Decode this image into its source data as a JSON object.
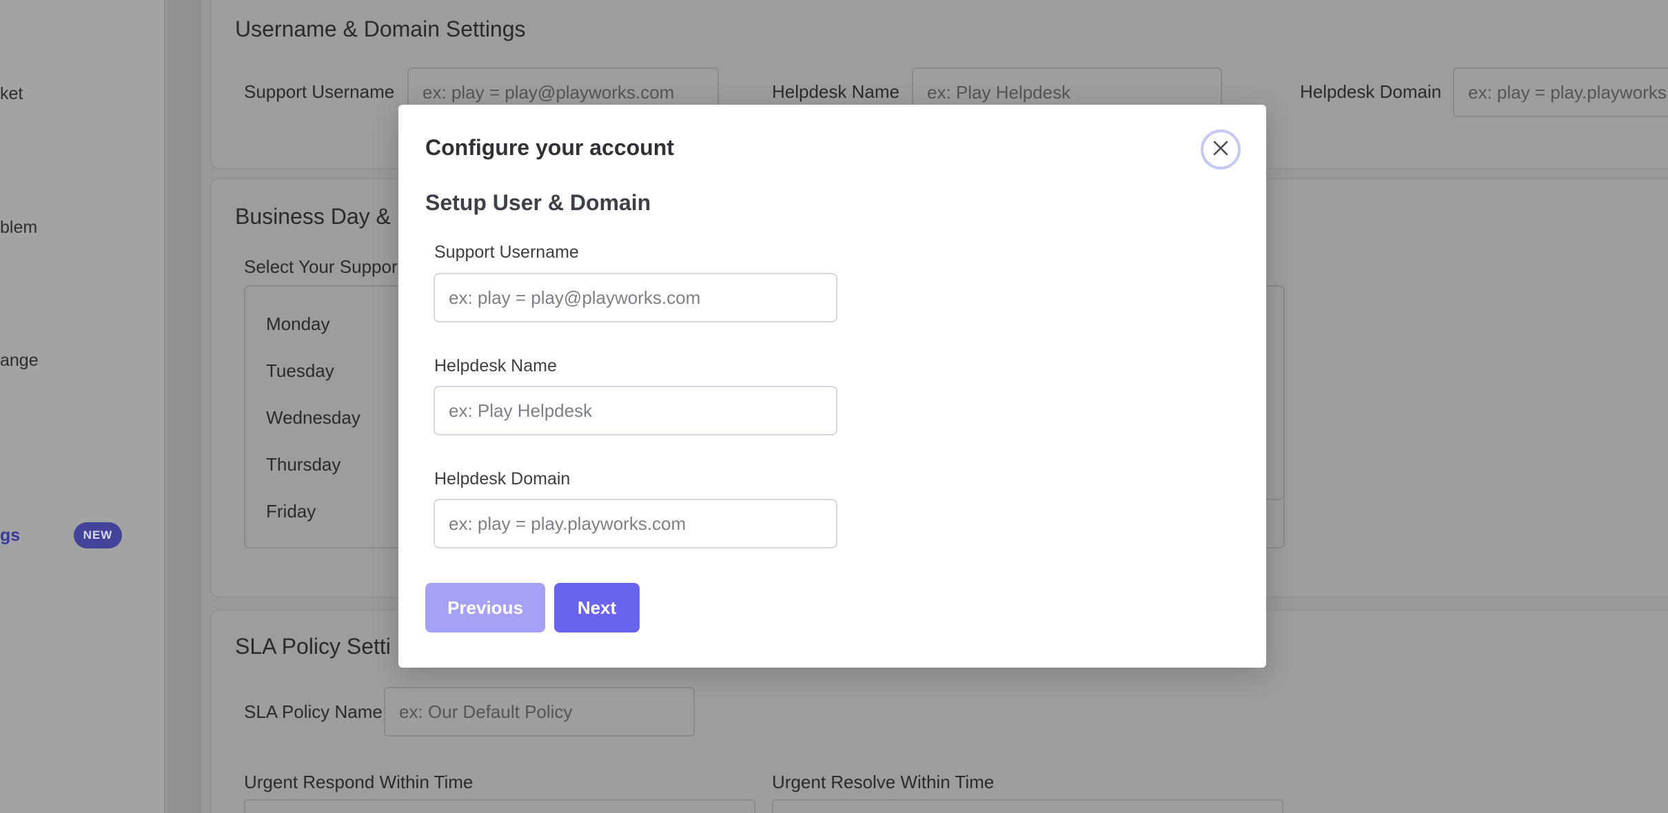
{
  "sidebar": {
    "items": [
      {
        "label": "ket"
      },
      {
        "label": "blem"
      },
      {
        "label": "ange"
      },
      {
        "label": "gs"
      }
    ],
    "badge": "NEW"
  },
  "background": {
    "username_section": {
      "title": "Username & Domain Settings",
      "support_username_label": "Support Username",
      "support_username_placeholder": "ex: play = play@playworks.com",
      "helpdesk_name_label": "Helpdesk Name",
      "helpdesk_name_placeholder": "ex: Play Helpdesk",
      "helpdesk_domain_label": "Helpdesk Domain",
      "helpdesk_domain_placeholder": "ex: play = play.playworks.com"
    },
    "business_section": {
      "title": "Business Day &",
      "select_label": "Select Your Suppor",
      "days": [
        "Monday",
        "Tuesday",
        "Wednesday",
        "Thursday",
        "Friday"
      ]
    },
    "sla_section": {
      "title": "SLA Policy Setti",
      "policy_name_label": "SLA Policy Name",
      "policy_name_placeholder": "ex: Our Default Policy",
      "urgent_respond_label": "Urgent Respond Within Time",
      "urgent_resolve_label": "Urgent Resolve Within Time"
    }
  },
  "modal": {
    "title": "Configure your account",
    "subtitle": "Setup User & Domain",
    "fields": [
      {
        "label": "Support Username",
        "placeholder": "ex: play = play@playworks.com",
        "value": ""
      },
      {
        "label": "Helpdesk Name",
        "placeholder": "ex: Play Helpdesk",
        "value": ""
      },
      {
        "label": "Helpdesk Domain",
        "placeholder": "ex: play = play.playworks.com",
        "value": ""
      }
    ],
    "previous_label": "Previous",
    "next_label": "Next",
    "close_icon": "close-icon"
  },
  "colors": {
    "accent": "#6a63ee",
    "accent_disabled": "#a5a2f6",
    "overlay": "#999999"
  }
}
